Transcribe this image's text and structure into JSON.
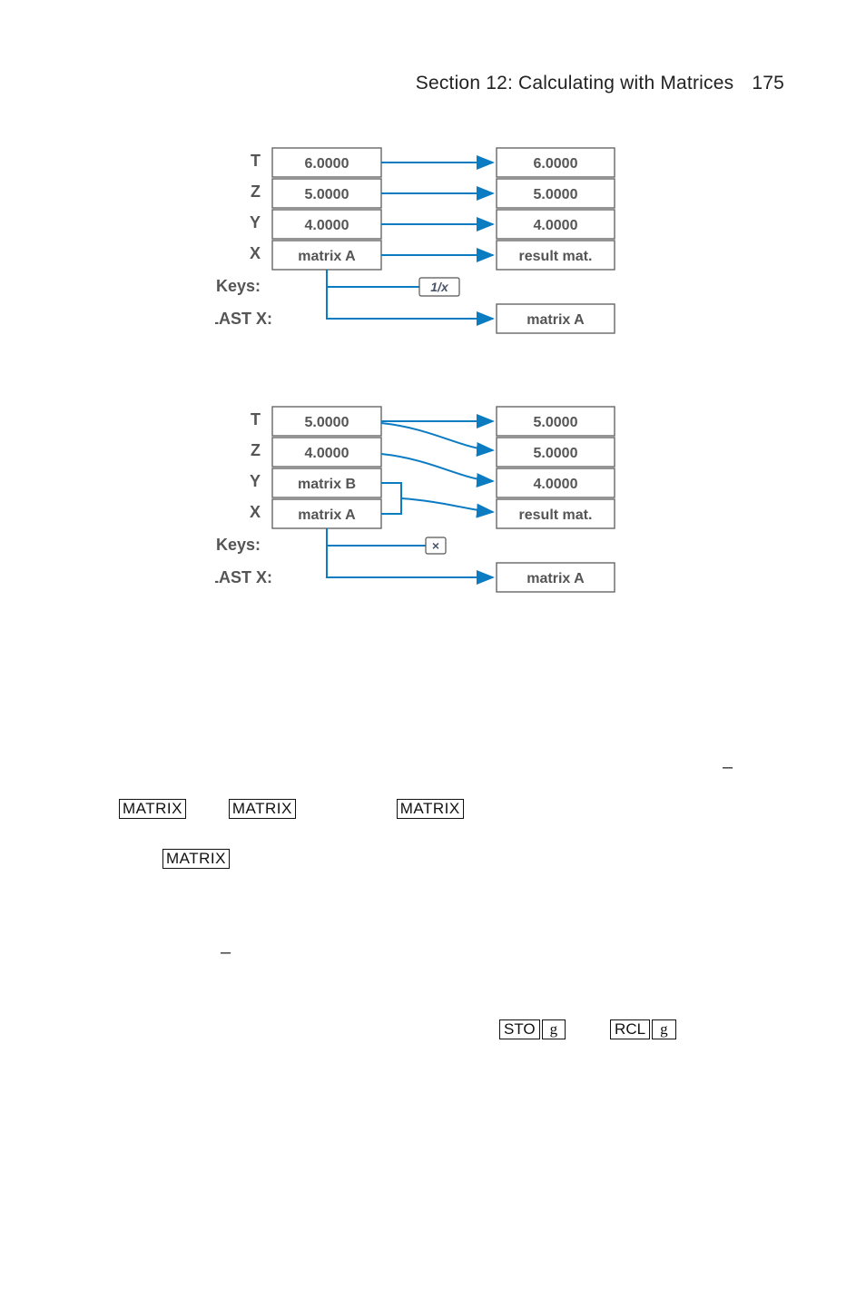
{
  "header": {
    "section": "Section 12: Calculating with Matrices",
    "page": "175"
  },
  "diagram1": {
    "rows": [
      "T",
      "Z",
      "Y",
      "X"
    ],
    "left": [
      "6.0000",
      "5.0000",
      "4.0000",
      "matrix A"
    ],
    "right": [
      "6.0000",
      "5.0000",
      "4.0000",
      "result mat."
    ],
    "keylabel": "Keys:",
    "key": "1/x",
    "lastx_label": "LAST X:",
    "lastx_value": "matrix A"
  },
  "diagram2": {
    "rows": [
      "T",
      "Z",
      "Y",
      "X"
    ],
    "left": [
      "5.0000",
      "4.0000",
      "matrix B",
      "matrix A"
    ],
    "right": [
      "5.0000",
      "5.0000",
      "4.0000",
      "result mat."
    ],
    "keylabel": "Keys:",
    "key": "×",
    "lastx_label": "LAST X:",
    "lastx_value": "matrix A"
  },
  "keys": {
    "matrix": "MATRIX",
    "sto": "STO",
    "rcl": "RCL",
    "g": "g"
  },
  "dashes": {
    "d": "–"
  }
}
